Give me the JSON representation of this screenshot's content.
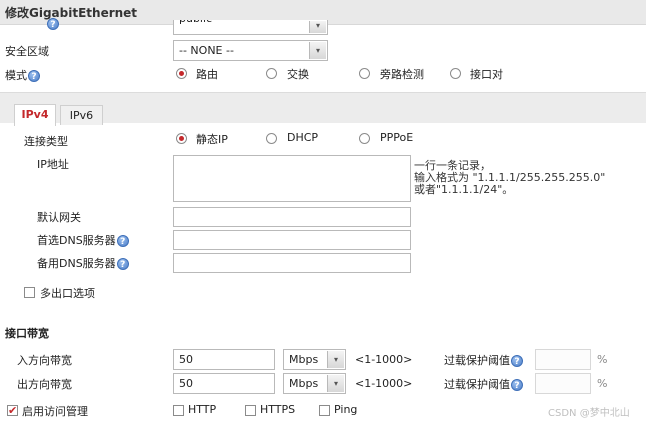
{
  "dialog": {
    "title": "修改GigabitEthernet"
  },
  "top": {
    "partial_select_value": "public"
  },
  "zone": {
    "label": "安全区域",
    "value": "-- NONE --"
  },
  "mode": {
    "label": "模式",
    "options": [
      "路由",
      "交换",
      "旁路检测",
      "接口对"
    ],
    "selected": "路由"
  },
  "tabs": [
    {
      "label": "IPv4",
      "active": true
    },
    {
      "label": "IPv6",
      "active": false
    }
  ],
  "conn": {
    "label": "连接类型",
    "options": [
      "静态IP",
      "DHCP",
      "PPPoE"
    ],
    "selected": "静态IP"
  },
  "ip": {
    "label": "IP地址",
    "value": "",
    "hint_lines": [
      "一行一条记录，",
      "输入格式为 \"1.1.1.1/255.255.255.0\"",
      "或者\"1.1.1.1/24\"。"
    ]
  },
  "gateway": {
    "label": "默认网关",
    "value": ""
  },
  "dns1": {
    "label": "首选DNS服务器",
    "value": ""
  },
  "dns2": {
    "label": "备用DNS服务器",
    "value": ""
  },
  "multi": {
    "label": "多出口选项",
    "checked": false
  },
  "bandwidth": {
    "section_label": "接口带宽",
    "rows": [
      {
        "label": "入方向带宽",
        "value": "50",
        "unit": "Mbps",
        "range": "<1-1000>",
        "protect_label": "过载保护阈值",
        "percent": "%"
      },
      {
        "label": "出方向带宽",
        "value": "50",
        "unit": "Mbps",
        "range": "<1-1000>",
        "protect_label": "过载保护阈值",
        "percent": "%"
      }
    ]
  },
  "access": {
    "label": "启用访问管理",
    "checked": true,
    "options": [
      {
        "label": "HTTP",
        "checked": false
      },
      {
        "label": "HTTPS",
        "checked": false
      },
      {
        "label": "Ping",
        "checked": false
      }
    ]
  },
  "watermark": "CSDN @梦中北山"
}
